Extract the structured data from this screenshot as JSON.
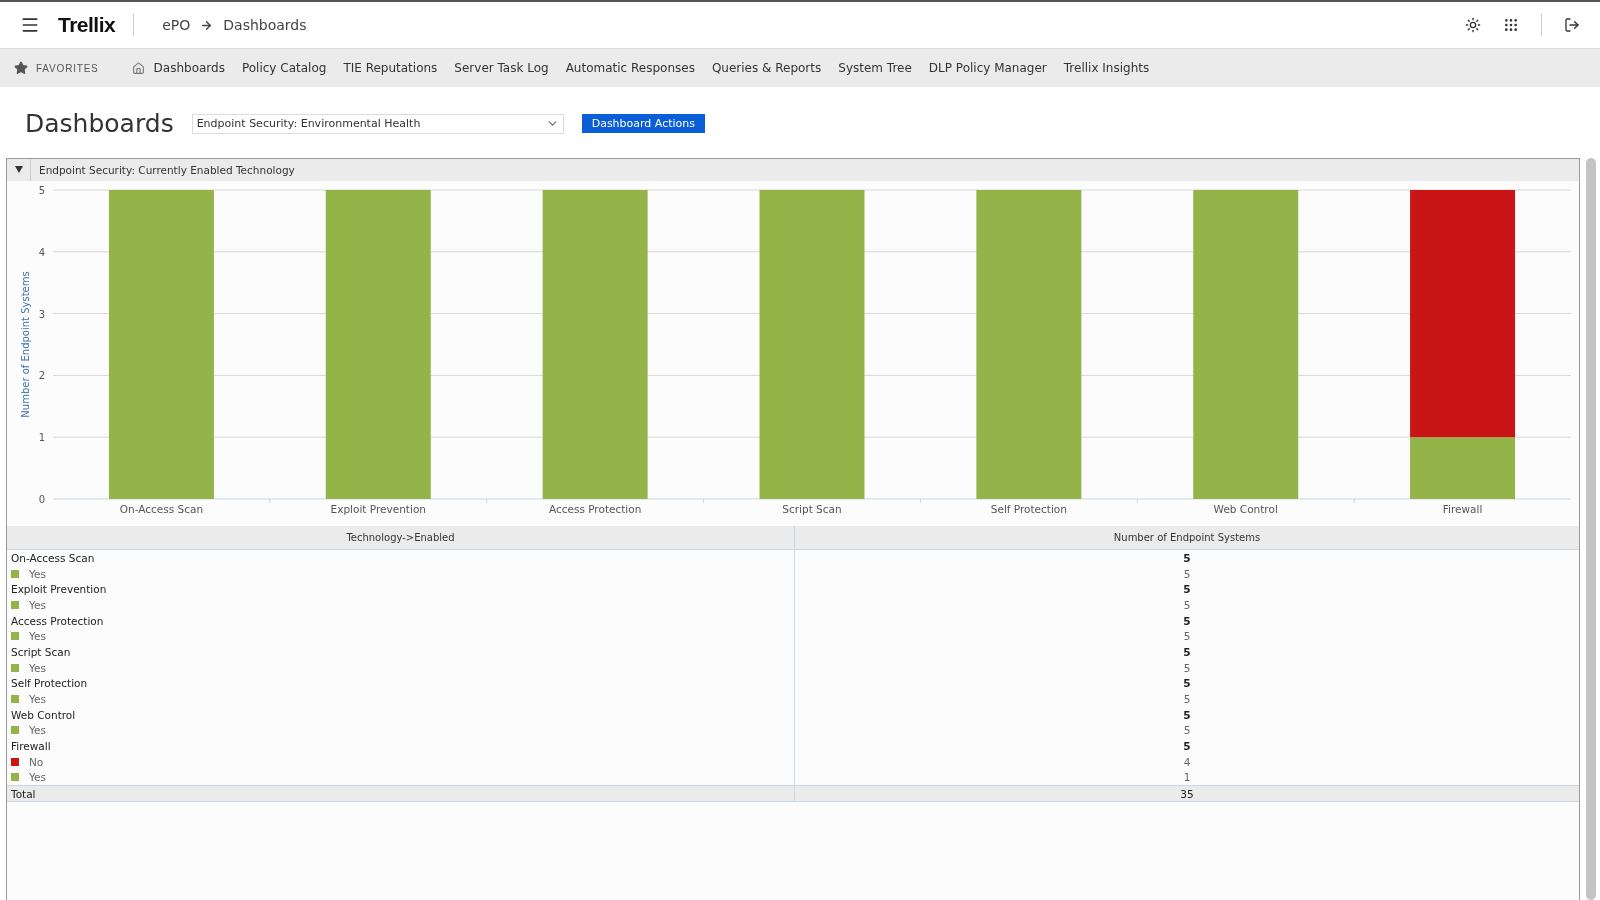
{
  "header": {
    "logo": "Trellix",
    "breadcrumb": [
      "ePO",
      "Dashboards"
    ]
  },
  "nav": {
    "favorites": "FAVORITES",
    "items": [
      {
        "label": "Dashboards",
        "kind": "home"
      },
      {
        "label": "Policy Catalog",
        "kind": "link"
      },
      {
        "label": "TIE Reputations",
        "kind": "link"
      },
      {
        "label": "Server Task Log",
        "kind": "link"
      },
      {
        "label": "Automatic Responses",
        "kind": "link"
      },
      {
        "label": "Queries & Reports",
        "kind": "link"
      },
      {
        "label": "System Tree",
        "kind": "link"
      },
      {
        "label": "DLP Policy Manager",
        "kind": "link"
      },
      {
        "label": "Trellix Insights",
        "kind": "link"
      }
    ]
  },
  "page": {
    "title": "Dashboards",
    "dashboard_select": "Endpoint Security: Environmental Health",
    "actions_button": "Dashboard Actions"
  },
  "panel": {
    "title": "Endpoint Security: Currently Enabled Technology",
    "expanded": true,
    "chart_data": {
      "type": "bar",
      "stacked": true,
      "ylabel": "Number of Endpoint Systems",
      "categories": [
        "On-Access Scan",
        "Exploit Prevention",
        "Access Protection",
        "Script Scan",
        "Self Protection",
        "Web Control",
        "Firewall"
      ],
      "series": [
        {
          "color": "#94b44a",
          "values": [
            5,
            5,
            5,
            5,
            5,
            5,
            1
          ]
        },
        {
          "color": "#c91515",
          "values": [
            0,
            0,
            0,
            0,
            0,
            0,
            4
          ]
        }
      ],
      "grid": true,
      "ylim": [
        0,
        5
      ],
      "yticks": [
        0,
        1,
        2,
        3,
        4,
        5
      ]
    },
    "table": {
      "columns": [
        "Technology->Enabled",
        "Number of Endpoint Systems"
      ],
      "groups": [
        {
          "name": "On-Access Scan",
          "count": "5",
          "items": [
            {
              "label": "Yes",
              "color": "#94b44a",
              "count": "5"
            }
          ]
        },
        {
          "name": "Exploit Prevention",
          "count": "5",
          "items": [
            {
              "label": "Yes",
              "color": "#94b44a",
              "count": "5"
            }
          ]
        },
        {
          "name": "Access Protection",
          "count": "5",
          "items": [
            {
              "label": "Yes",
              "color": "#94b44a",
              "count": "5"
            }
          ]
        },
        {
          "name": "Script Scan",
          "count": "5",
          "items": [
            {
              "label": "Yes",
              "color": "#94b44a",
              "count": "5"
            }
          ]
        },
        {
          "name": "Self Protection",
          "count": "5",
          "items": [
            {
              "label": "Yes",
              "color": "#94b44a",
              "count": "5"
            }
          ]
        },
        {
          "name": "Web Control",
          "count": "5",
          "items": [
            {
              "label": "Yes",
              "color": "#94b44a",
              "count": "5"
            }
          ]
        },
        {
          "name": "Firewall",
          "count": "5",
          "items": [
            {
              "label": "No",
              "color": "#c91515",
              "count": "4"
            },
            {
              "label": "Yes",
              "color": "#94b44a",
              "count": "1"
            }
          ]
        }
      ],
      "total": {
        "label": "Total",
        "count": "35"
      }
    }
  }
}
